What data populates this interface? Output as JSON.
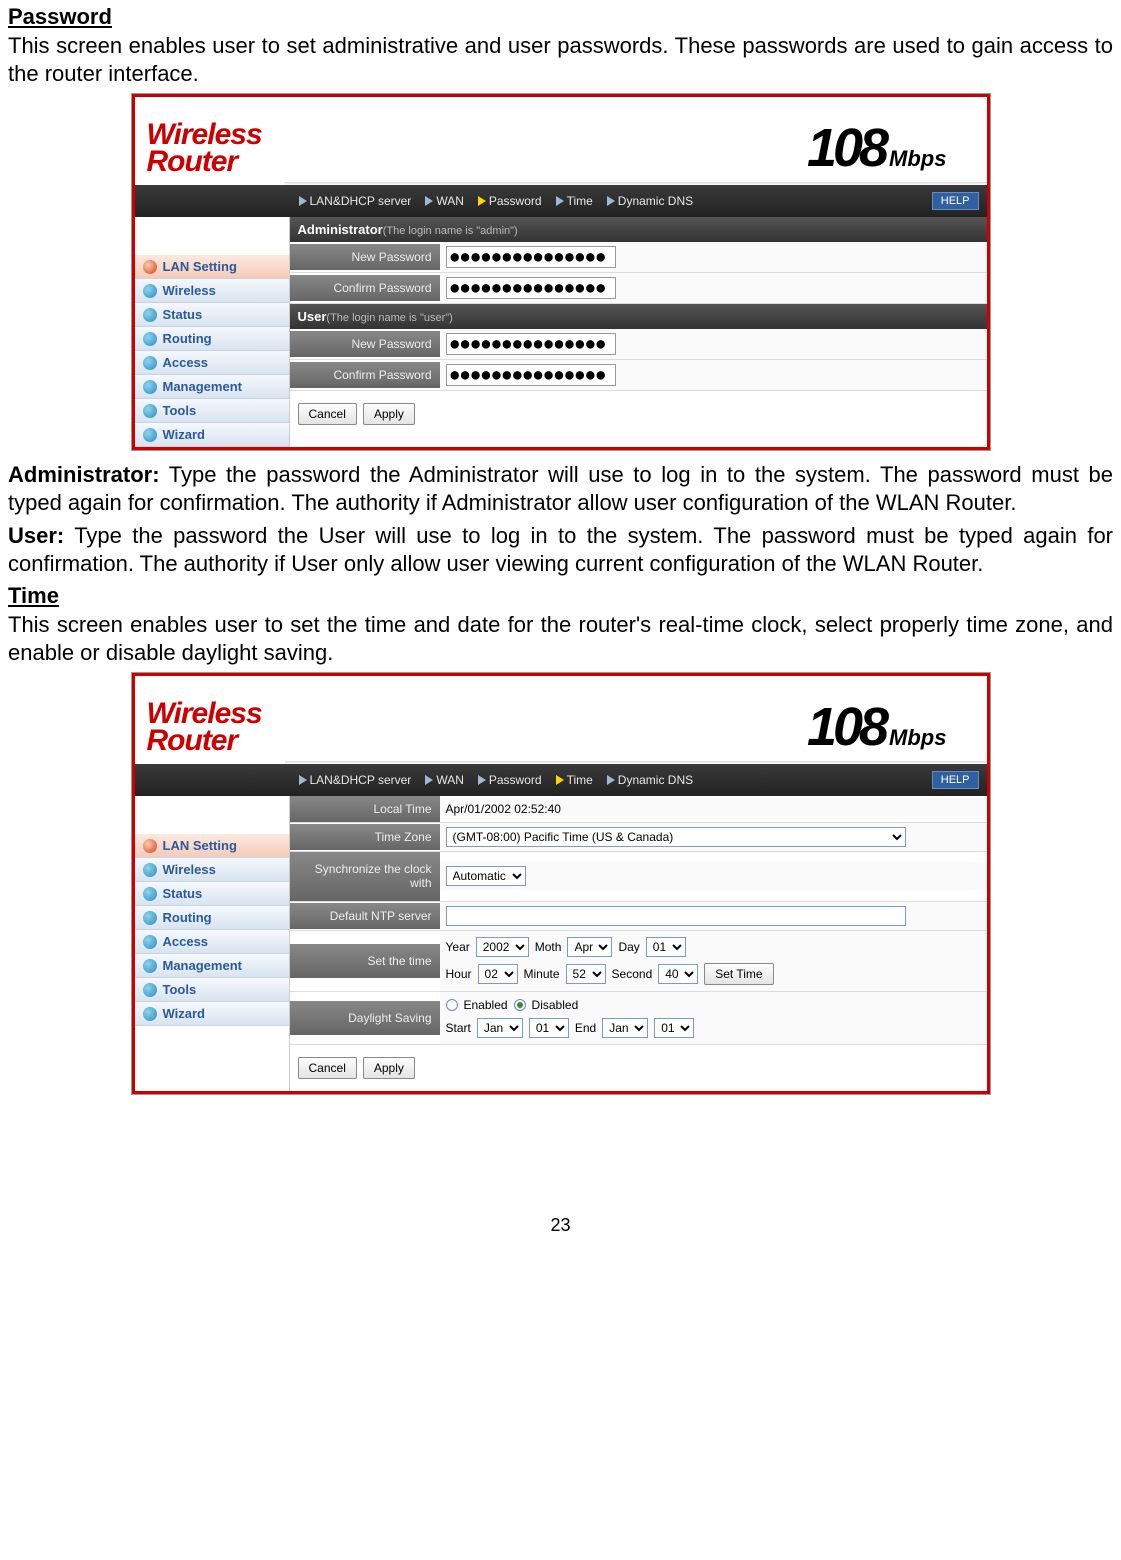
{
  "sections": {
    "password_title": "Password",
    "password_intro": "This screen enables user to set administrative and user passwords. These passwords are used to gain access to the router interface.",
    "admin_desc_label": "Administrator:",
    "admin_desc": " Type the password the Administrator will use to log in to the system. The password must be typed again for confirmation. The authority if Administrator allow user configuration of the WLAN Router.",
    "user_desc_label": "User:",
    "user_desc": " Type the password the User will use to log in to the system. The password must be typed again for confirmation. The authority if User only allow user viewing current configuration of the WLAN Router.",
    "time_title": "Time",
    "time_intro": "This screen enables user to set the time and date for the router's real-time clock, select properly time zone, and enable or disable daylight saving.",
    "page_number": "23"
  },
  "router": {
    "logo_line1": "Wireless",
    "logo_line2": "Router",
    "mbps_num": "108",
    "mbps_label": "Mbps",
    "tabs": [
      "LAN&DHCP server",
      "WAN",
      "Password",
      "Time",
      "Dynamic DNS"
    ],
    "help": "HELP",
    "nav": [
      "LAN Setting",
      "Wireless",
      "Status",
      "Routing",
      "Access",
      "Management",
      "Tools",
      "Wizard"
    ],
    "password": {
      "admin_header": "Administrator",
      "admin_sub": "(The login name is \"admin\")",
      "user_header": "User",
      "user_sub": "(The login name is \"user\")",
      "new_pw": "New Password",
      "confirm_pw": "Confirm Password",
      "pw_value": "●●●●●●●●●●●●●●●"
    },
    "time": {
      "local_time_label": "Local Time",
      "local_time_value": "Apr/01/2002 02:52:40",
      "tz_label": "Time Zone",
      "tz_value": "(GMT-08:00) Pacific Time (US & Canada)",
      "sync_label": "Synchronize the clock with",
      "sync_value": "Automatic",
      "ntp_label": "Default NTP server",
      "ntp_value": "",
      "set_time_label": "Set the time",
      "year_label": "Year",
      "year": "2002",
      "month_label": "Moth",
      "month": "Apr",
      "day_label": "Day",
      "day": "01",
      "hour_label": "Hour",
      "hour": "02",
      "minute_label": "Minute",
      "minute": "52",
      "second_label": "Second",
      "second": "40",
      "set_time_btn": "Set Time",
      "dst_label": "Daylight Saving",
      "enabled": "Enabled",
      "disabled": "Disabled",
      "start": "Start",
      "end": "End",
      "dst_month": "Jan",
      "dst_day": "01"
    },
    "cancel": "Cancel",
    "apply": "Apply"
  }
}
